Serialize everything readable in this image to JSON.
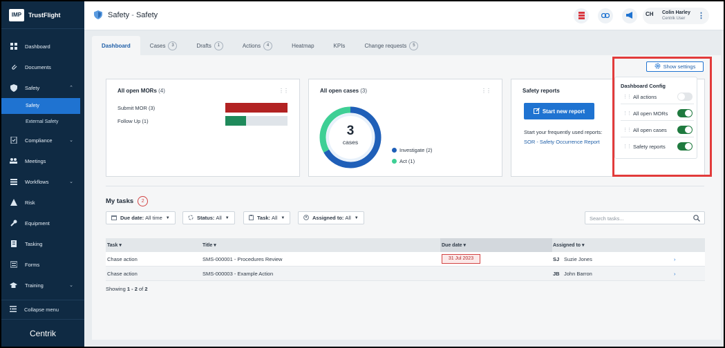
{
  "sidebar": {
    "logo": "IMP",
    "brand": "TrustFlight",
    "items": [
      {
        "label": "Dashboard"
      },
      {
        "label": "Documents"
      },
      {
        "label": "Safety"
      },
      {
        "label": "Compliance"
      },
      {
        "label": "Meetings"
      },
      {
        "label": "Workflows"
      },
      {
        "label": "Risk"
      },
      {
        "label": "Equipment"
      },
      {
        "label": "Tasking"
      },
      {
        "label": "Forms"
      },
      {
        "label": "Training"
      }
    ],
    "safety_sub": [
      "Safety",
      "External Safety"
    ],
    "collapse": "Collapse menu",
    "footer_brand": "Centrik"
  },
  "header": {
    "module": "Safety",
    "separator": " - ",
    "page": "Safety",
    "user_initials": "CH",
    "user_name": "Colin Harley",
    "user_role": "Centrik User"
  },
  "tabs": [
    {
      "label": "Dashboard",
      "badge": ""
    },
    {
      "label": "Cases",
      "badge": "3"
    },
    {
      "label": "Drafts",
      "badge": "1"
    },
    {
      "label": "Actions",
      "badge": "4"
    },
    {
      "label": "Heatmap",
      "badge": ""
    },
    {
      "label": "KPIs",
      "badge": ""
    },
    {
      "label": "Change requests",
      "badge": "5"
    }
  ],
  "show_settings": "Show settings",
  "mors": {
    "title": "All open MORs",
    "count": "(4)",
    "rows": [
      {
        "label": "Submit MOR (3)",
        "fraction": 1.0,
        "color": "#b22222"
      },
      {
        "label": "Follow Up (1)",
        "fraction": 0.33,
        "color": "#1f8a5b"
      }
    ]
  },
  "cases": {
    "title": "All open cases",
    "count": "(3)",
    "center_value": "3",
    "center_label": "cases",
    "legend": [
      {
        "label": "Investigate (2)",
        "color": "#1f5fb8"
      },
      {
        "label": "Act (1)",
        "color": "#3ecf95"
      }
    ]
  },
  "reports": {
    "title": "Safety reports",
    "button": "Start new report",
    "text": "Start your frequently used reports:",
    "link": "SOR - Safety Occurrence Report"
  },
  "config": {
    "title": "Dashboard Config",
    "items": [
      {
        "label": "All actions",
        "on": false
      },
      {
        "label": "All open MORs",
        "on": true
      },
      {
        "label": "All open cases",
        "on": true
      },
      {
        "label": "Safety reports",
        "on": true
      }
    ]
  },
  "tasks": {
    "title": "My tasks",
    "count": "2",
    "filters": [
      {
        "label": "Due date:",
        "value": "All time"
      },
      {
        "label": "Status:",
        "value": "All"
      },
      {
        "label": "Task:",
        "value": "All"
      },
      {
        "label": "Assigned to:",
        "value": "All"
      }
    ],
    "search_placeholder": "Search tasks...",
    "columns": [
      "Task",
      "Title",
      "Due date",
      "Assigned to"
    ],
    "rows": [
      {
        "task": "Chase action",
        "title": "SMS-000001 - Procedures Review",
        "due": "31 Jul 2023",
        "initials": "SJ",
        "assignee": "Suzie Jones"
      },
      {
        "task": "Chase action",
        "title": "SMS-000003 - Example Action",
        "due": "",
        "initials": "JB",
        "assignee": "John Barron"
      }
    ],
    "showing_prefix": "Showing ",
    "showing_range": "1 - 2",
    "showing_of": " of ",
    "showing_total": "2"
  }
}
